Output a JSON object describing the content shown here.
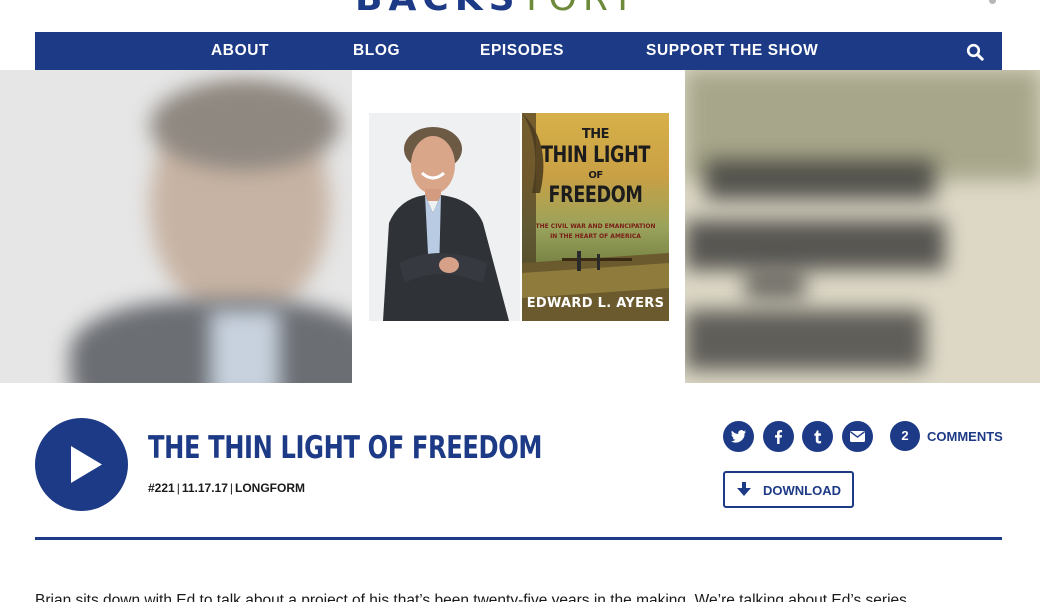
{
  "site": {
    "logo_main": "BACKS",
    "logo_accent": "TORY",
    "nav": [
      {
        "label": "ABOUT",
        "icon": ""
      },
      {
        "label": "BLOG",
        "icon": ""
      },
      {
        "label": "EPISODES",
        "icon": ""
      },
      {
        "label": "SUPPORT THE SHOW",
        "icon": ""
      }
    ],
    "search_icon": "search-icon"
  },
  "hero": {
    "book_title_line1": "THE",
    "book_title_line2": "THIN LIGHT",
    "book_title_line3": "OF",
    "book_title_line4": "FREEDOM",
    "book_subtitle_line1": "THE CIVIL WAR AND EMANCIPATION",
    "book_subtitle_line2": "IN THE HEART OF AMERICA",
    "book_author": "EDWARD L. AYERS"
  },
  "episode": {
    "title": "THE THIN LIGHT OF FREEDOM",
    "number": "#221",
    "date": "11.17.17",
    "series": "LONGFORM",
    "comment_count": "2",
    "comments_label": "COMMENTS",
    "download_label": "DOWNLOAD",
    "share_icons": [
      "twitter-icon",
      "facebook-icon",
      "tumblr-icon",
      "email-icon"
    ]
  },
  "article": {
    "intro": "Brian sits down with Ed to talk about a project of his that’s been twenty-five years in the making. We’re talking about Ed’s series"
  },
  "colors": {
    "brand_blue": "#1d3a86",
    "accent_green": "#6c8a3a"
  }
}
